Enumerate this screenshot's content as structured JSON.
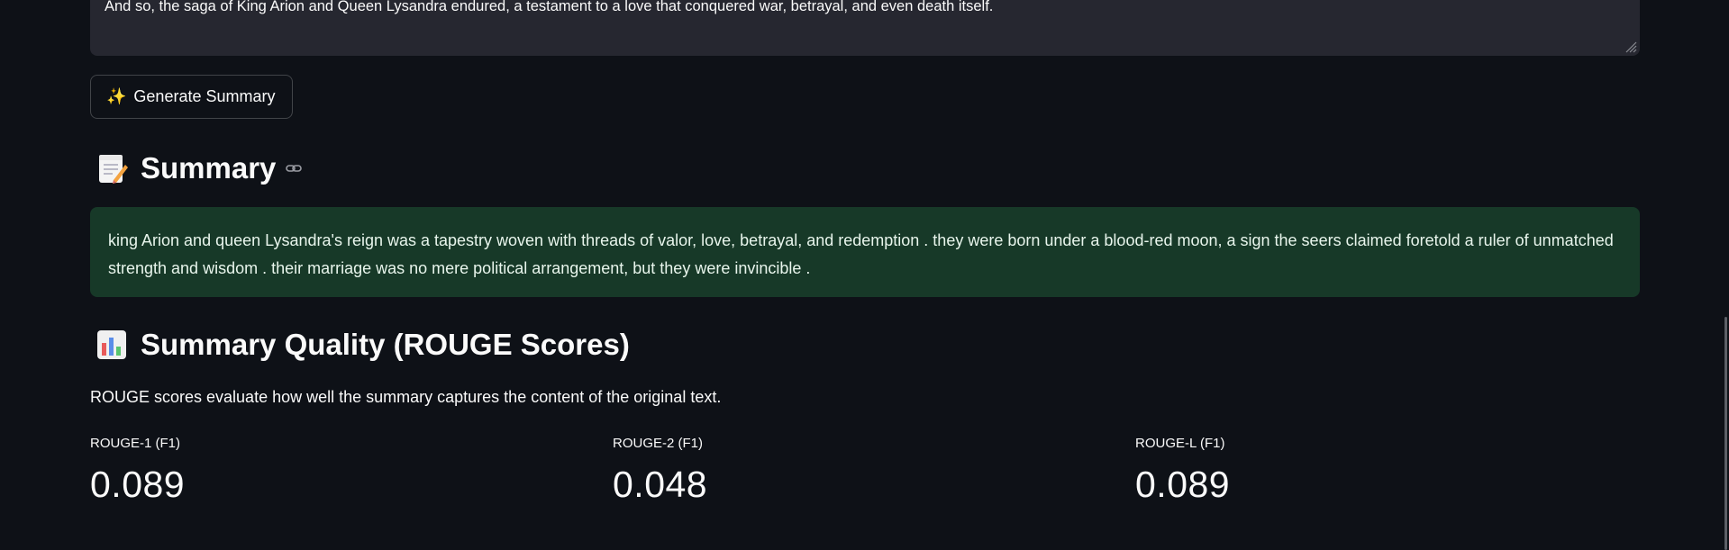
{
  "input_text": {
    "last_line": "And so, the saga of King Arion and Queen Lysandra endured, a testament to a love that conquered war, betrayal, and even death itself."
  },
  "generate_button": {
    "icon": "sparkles-icon",
    "label": "Generate Summary"
  },
  "summary_section": {
    "icon": "memo-icon",
    "title": "Summary",
    "text": "king Arion and queen Lysandra's reign was a tapestry woven with threads of valor, love, betrayal, and redemption . they were born under a blood-red moon, a sign the seers claimed foretold a ruler of unmatched strength and wisdom . their marriage was no mere political arrangement, but they were invincible ."
  },
  "rouge_section": {
    "icon": "bar-chart-icon",
    "title": "Summary Quality (ROUGE Scores)",
    "description": "ROUGE scores evaluate how well the summary captures the content of the original text.",
    "metrics": [
      {
        "label": "ROUGE-1 (F1)",
        "value": "0.089"
      },
      {
        "label": "ROUGE-2 (F1)",
        "value": "0.048"
      },
      {
        "label": "ROUGE-L (F1)",
        "value": "0.089"
      }
    ]
  },
  "colors": {
    "background": "#0e1117",
    "input_background": "#262730",
    "success_background": "#173928",
    "text": "#fafafa"
  }
}
